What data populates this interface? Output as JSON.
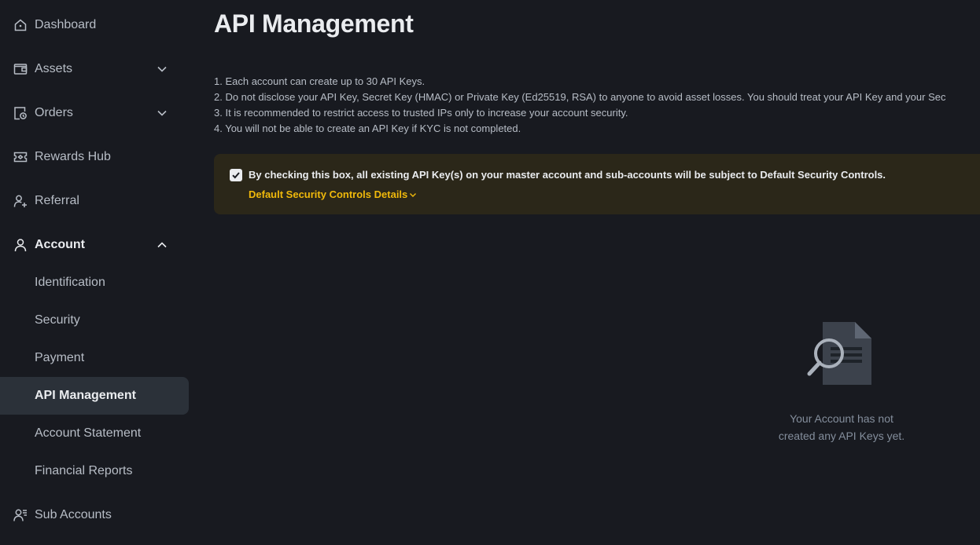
{
  "sidebar": {
    "items": [
      {
        "label": "Dashboard",
        "icon": "home-icon"
      },
      {
        "label": "Assets",
        "icon": "wallet-icon"
      },
      {
        "label": "Orders",
        "icon": "orders-icon"
      },
      {
        "label": "Rewards Hub",
        "icon": "ticket-icon"
      },
      {
        "label": "Referral",
        "icon": "add-user-icon"
      },
      {
        "label": "Account",
        "icon": "user-icon"
      }
    ],
    "account_sub_items": [
      {
        "label": "Identification"
      },
      {
        "label": "Security"
      },
      {
        "label": "Payment"
      },
      {
        "label": "API Management",
        "selected": true
      },
      {
        "label": "Account Statement"
      },
      {
        "label": "Financial Reports"
      }
    ],
    "bottom_item": {
      "label": "Sub Accounts",
      "icon": "sub-accounts-icon"
    }
  },
  "main": {
    "title": "API Management",
    "notes": [
      "1. Each account can create up to 30 API Keys.",
      "2. Do not disclose your API Key, Secret Key (HMAC) or Private Key (Ed25519, RSA) to anyone to avoid asset losses. You should treat your API Key and your Sec",
      "3. It is recommended to restrict access to trusted IPs only to increase your account security.",
      "4. You will not be able to create an API Key if KYC is not completed."
    ],
    "security_notice": {
      "checked": true,
      "text": "By checking this box, all existing API Key(s) on your master account and sub-accounts will be subject to Default Security Controls.",
      "link_label": "Default Security Controls Details"
    },
    "empty_state": {
      "line1": "Your Account has not",
      "line2": "created any API Keys yet."
    }
  },
  "colors": {
    "background": "#181a20",
    "selected_bg": "#2b3139",
    "notice_bg": "#2b2719",
    "accent": "#f0b90b",
    "text_primary": "#eaecef",
    "text_secondary": "#b7bdc6",
    "text_muted": "#848e9c"
  }
}
